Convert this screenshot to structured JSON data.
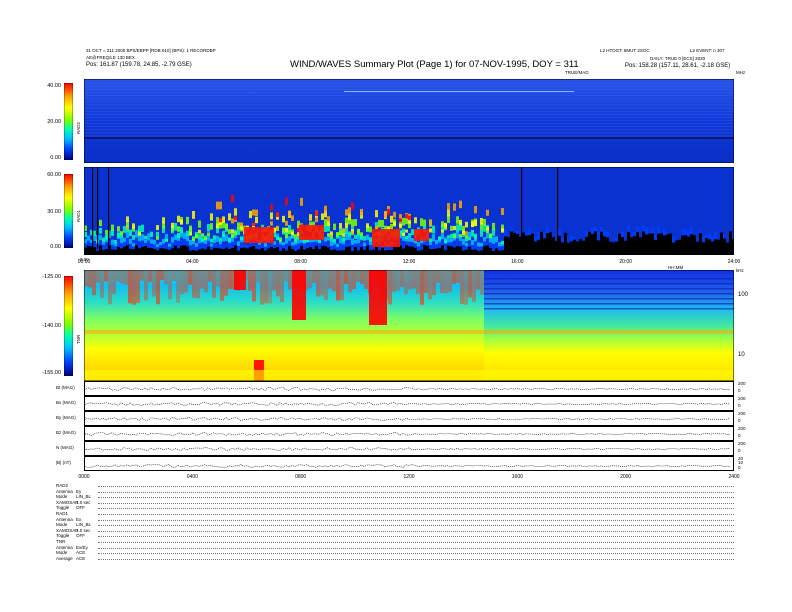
{
  "header": {
    "title": "WIND/WAVES Summary Plot (Page 1) for 07-NOV-1995, DOY = 311",
    "left_line1": "31 OCT = 311 2000 BPS/EBPP [RDB 010] (BPS): 1 RECORDBP",
    "left_line2": "AE@FREQ/LE 130 BEX",
    "left_line3": "Pos:   161.87 (159.78, 24.85, -2.79 GSE)",
    "right_line1": "L2 HTOGT: 8MUT 2SOC",
    "right_line2": "L2 EVENT: n 307",
    "right_line3": "DAILY: TRUE 0 [ECS] 2020",
    "right_line4": "Pos:   158.28 (157.11, 28.61, -2.18 GSE)",
    "timing_label": "TRUE/MAG",
    "mhz_label": "MHz",
    "khz_label": "kHz"
  },
  "panels": {
    "rad2": {
      "label": "RAD2",
      "yticks": [
        "40.00",
        "20.00",
        "0.00"
      ]
    },
    "rad1": {
      "label": "RAD1",
      "yticks": [
        "60.00",
        "30.00",
        "0.00"
      ],
      "top_ticks": [
        "0.00",
        "20.00"
      ]
    },
    "tnr": {
      "label": "TNR",
      "yticks": [
        "-125.00",
        "-140.00",
        "-155.00"
      ],
      "right_ticks": [
        "100",
        "10"
      ]
    },
    "mag": [
      {
        "label": "Bt (MAG)",
        "scale": [
          "200",
          "0"
        ]
      },
      {
        "label": "Bx (MAG)",
        "scale": [
          "200",
          "0"
        ]
      },
      {
        "label": "By (MAG)",
        "scale": [
          "200",
          "0"
        ]
      },
      {
        "label": "Bz (MAG)",
        "scale": [
          "200",
          "0"
        ]
      },
      {
        "label": "N (MAG)",
        "scale": [
          "200",
          "0"
        ]
      },
      {
        "label": "|B| (nT)",
        "scale": [
          "20",
          "10",
          "0"
        ]
      }
    ]
  },
  "time_axis": {
    "labels": [
      "00:00",
      "04:00",
      "08:00",
      "12:00",
      "16:00",
      "20:00",
      "24:00"
    ],
    "bottom_labels": [
      "0000",
      "0400",
      "0800",
      "1200",
      "1600",
      "2000",
      "2400"
    ],
    "suffix": "HH:MM"
  },
  "bottom_list": [
    {
      "k": "RAD2",
      "v": ""
    },
    {
      "k": "Antenna",
      "v": "Ey"
    },
    {
      "k": "Mode",
      "v": "LIN_BL"
    },
    {
      "k": "XAMOSAP",
      "v": "1.0 sec"
    },
    {
      "k": "Toggle",
      "v": "OFF"
    },
    {
      "k": "RAD1",
      "v": ""
    },
    {
      "k": "Antenna",
      "v": "Ex"
    },
    {
      "k": "Mode",
      "v": "LIN_BL"
    },
    {
      "k": "XAMOSAP",
      "v": "1.0 sec"
    },
    {
      "k": "Toggle",
      "v": "OFF"
    },
    {
      "k": "TNR",
      "v": ""
    },
    {
      "k": "Antenna",
      "v": "Ex/Ey"
    },
    {
      "k": "Mode",
      "v": "ACE"
    },
    {
      "k": "Average",
      "v": "ACE"
    }
  ],
  "colors": {
    "bg_low": "#0a2fd6",
    "bg_high": "#ff0000",
    "cmap": [
      "#ff0000",
      "#ffa500",
      "#ffff00",
      "#7fff00",
      "#00ffb0",
      "#00bfff",
      "#0040ff",
      "#0000a0"
    ]
  },
  "chart_data": {
    "type": "heatmap",
    "title": "WIND/WAVES Summary Plot (Page 1) for 07-NOV-1995, DOY = 311",
    "x_range": [
      "00:00",
      "24:00"
    ],
    "panels": [
      {
        "name": "RAD2",
        "ylim": [
          0,
          40
        ]
      },
      {
        "name": "RAD1",
        "ylim": [
          0,
          60
        ]
      },
      {
        "name": "TNR",
        "ylim": [
          -155,
          -125
        ]
      }
    ]
  }
}
